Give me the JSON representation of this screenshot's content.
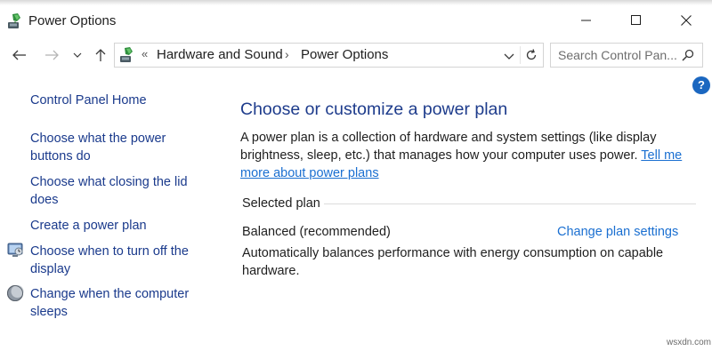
{
  "window": {
    "title": "Power Options",
    "controls": [
      "minimize",
      "maximize",
      "close"
    ]
  },
  "nav": {
    "back_icon": "back-arrow-icon",
    "forward_icon": "forward-arrow-icon",
    "recent_icon": "chevron-down-icon",
    "up_icon": "up-arrow-icon",
    "breadcrumb_overflow": "«",
    "breadcrumbs": [
      "Hardware and Sound",
      "Power Options"
    ],
    "search_placeholder": "Search Control Pan..."
  },
  "help": {
    "label": "?"
  },
  "sidebar": {
    "home": "Control Panel Home",
    "links": [
      {
        "label": "Choose what the power buttons do",
        "line1": "Choose what the power",
        "line2": "buttons do",
        "icon": ""
      },
      {
        "label": "Choose what closing the lid does",
        "line1": "Choose what closing the lid",
        "line2": "does",
        "icon": ""
      },
      {
        "label": "Create a power plan",
        "line1": "Create a power plan",
        "line2": "",
        "icon": ""
      },
      {
        "label": "Choose when to turn off the display",
        "line1": "Choose when to turn off the",
        "line2": "display",
        "icon": "monitor-icon"
      },
      {
        "label": "Change when the computer sleeps",
        "line1": "Change when the computer",
        "line2": "sleeps",
        "icon": "moon-sleep-icon"
      }
    ]
  },
  "main": {
    "heading": "Choose or customize a power plan",
    "description": "A power plan is a collection of hardware and system settings (like display brightness, sleep, etc.) that manages how your computer uses power.",
    "learn_more": "Tell me more about power plans",
    "section_label": "Selected plan",
    "plan": {
      "name": "Balanced (recommended)",
      "change_link": "Change plan settings",
      "description": "Automatically balances performance with energy consumption on capable hardware."
    }
  },
  "watermark": "wsxdn.com",
  "colors": {
    "link": "#1a6fd1",
    "heading": "#1e3c8c",
    "help_badge": "#1b67c0"
  }
}
